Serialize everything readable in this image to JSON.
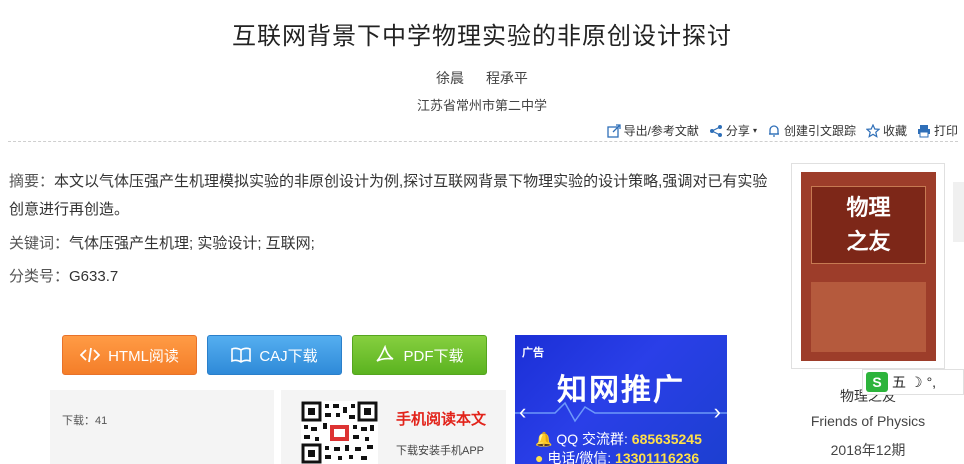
{
  "article": {
    "title": "互联网背景下中学物理实验的非原创设计探讨",
    "authors": [
      "徐晨",
      "程承平"
    ],
    "organization": "江苏省常州市第二中学"
  },
  "toolbar": {
    "export": "导出/参考文献",
    "share": "分享",
    "citation": "创建引文跟踪",
    "favorite": "收藏",
    "print": "打印"
  },
  "abstract": {
    "label": "摘要：",
    "text": "本文以气体压强产生机理模拟实验的非原创设计为例,探讨互联网背景下物理实验的设计策略,强调对已有实验创意进行再创造。"
  },
  "keywords": {
    "label": "关键词：",
    "items": "气体压强产生机理; 实验设计; 互联网;"
  },
  "classification": {
    "label": "分类号：",
    "value": "G633.7"
  },
  "buttons": {
    "html": "HTML阅读",
    "caj": "CAJ下载",
    "pdf": "PDF下载"
  },
  "downloads": {
    "label": "下载：",
    "count": "41"
  },
  "mobile": {
    "title": "手机阅读本文",
    "subtitle": "下载安装手机APP"
  },
  "ad": {
    "tag": "广告",
    "title": "知网推广",
    "qq_label": "QQ 交流群:",
    "qq_value": "685635245",
    "phone_label": "电话/微信:",
    "phone_value": "13301116236"
  },
  "journal": {
    "cover_text_1": "物理",
    "cover_text_2": "之友",
    "name": "物理之友",
    "english_name": "Friends of Physics",
    "issue": "2018年12期"
  },
  "ime": {
    "logo": "S",
    "mode": "五"
  },
  "colors": {
    "html_button": "#f47e29",
    "caj_button": "#2f8ad8",
    "pdf_button": "#5bb320",
    "ad_background": "#1b2fd6",
    "mobile_title": "#e2231a"
  }
}
